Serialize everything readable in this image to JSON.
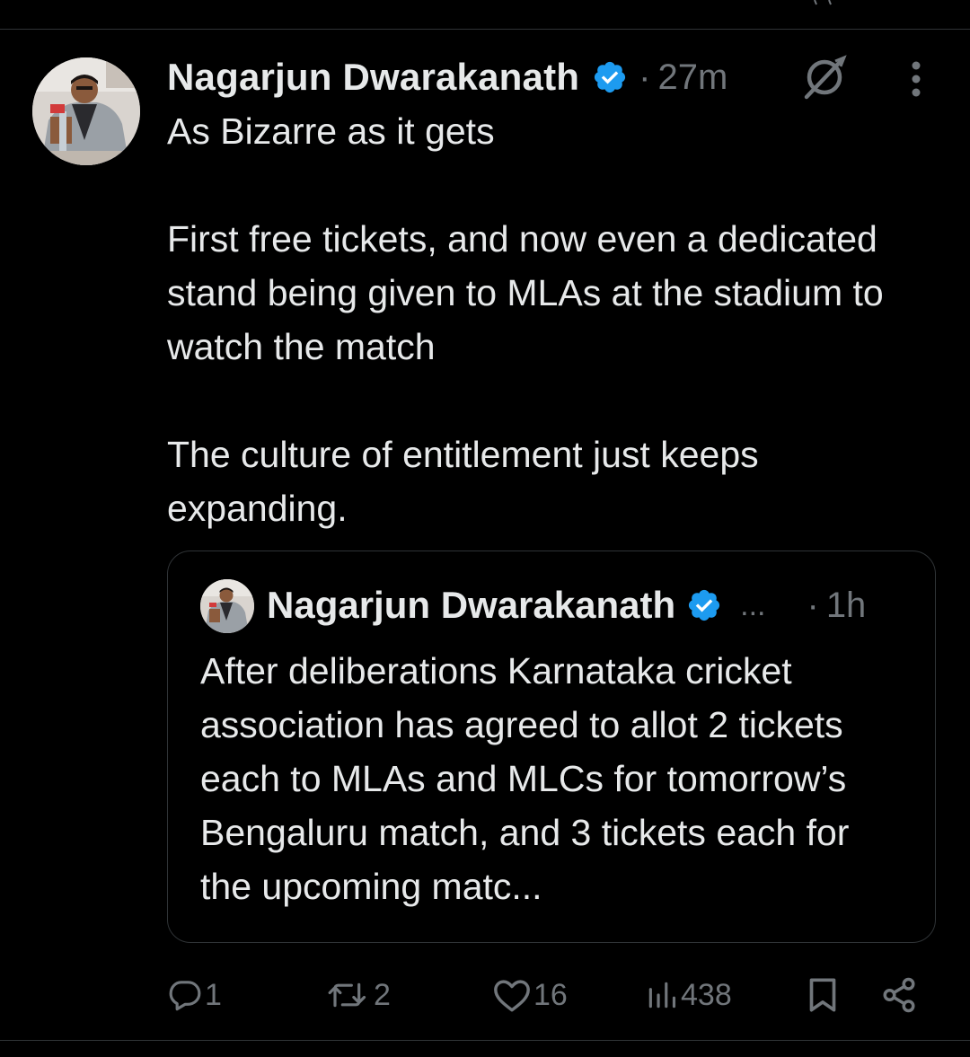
{
  "tweet": {
    "author_name": "Nagarjun Dwarakanath",
    "separator": "·",
    "timestamp": "27m",
    "verified": true,
    "text_lines": [
      "As Bizarre as it gets",
      "First free tickets, and now even a dedicated stand being given to MLAs at the stadium to watch the match",
      "The culture of entitlement just keeps expanding."
    ]
  },
  "quoted_tweet": {
    "author_name": "Nagarjun Dwarakanath",
    "verified": true,
    "handle_ellipsis": "...",
    "separator": "·",
    "timestamp": "1h",
    "text": "After deliberations Karnataka cricket association has agreed to allot 2 tickets each to MLAs and MLCs for tomorrow’s Bengaluru match, and 3 tickets each for the upcoming matc..."
  },
  "actions": {
    "replies": "1",
    "reposts": "2",
    "likes": "16",
    "views": "438"
  },
  "icons": {
    "verified": "verified-badge-icon",
    "grok": "grok-icon",
    "more": "more-vertical-icon",
    "reply": "reply-icon",
    "repost": "repost-icon",
    "like": "heart-icon",
    "views": "views-bar-icon",
    "bookmark": "bookmark-icon",
    "share": "share-icon"
  },
  "colors": {
    "background": "#000000",
    "text_primary": "#e7e9ea",
    "text_secondary": "#71767b",
    "verified_blue": "#1d9bf0",
    "border": "#2f3336"
  }
}
